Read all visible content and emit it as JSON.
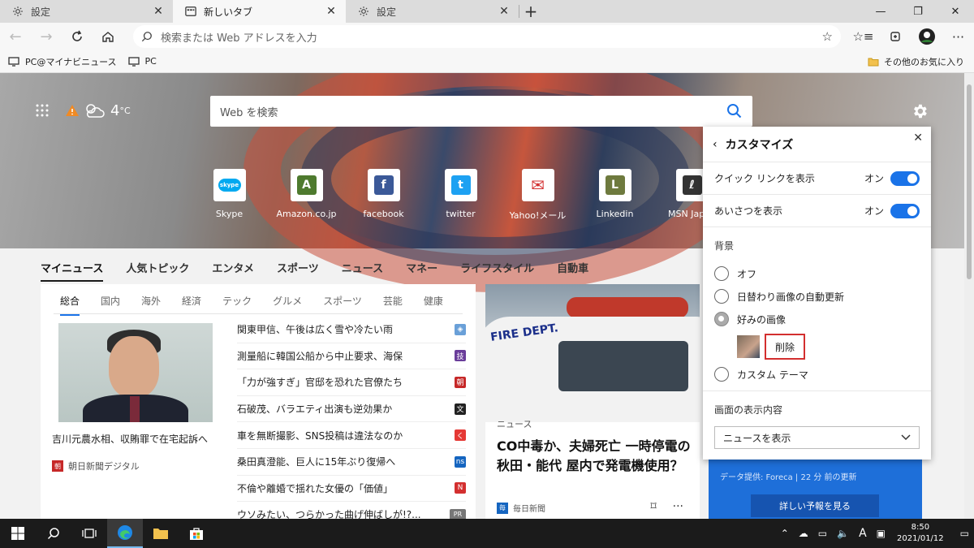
{
  "tabs": [
    {
      "label": "設定",
      "icon": "gear-icon"
    },
    {
      "label": "新しいタブ",
      "icon": "newtab-icon"
    },
    {
      "label": "設定",
      "icon": "gear-icon"
    }
  ],
  "address": {
    "placeholder": "検索または Web アドレスを入力"
  },
  "favorites": {
    "items": [
      {
        "label": "PC@マイナビニュース"
      },
      {
        "label": "PC"
      }
    ],
    "other": "その他のお気に入り"
  },
  "weather": {
    "temp": "4",
    "unit": "°C"
  },
  "search": {
    "placeholder": "Web を検索"
  },
  "quick_links": [
    {
      "label": "Skype",
      "icon": "skype-icon",
      "color": "#00a9f0",
      "glyph": "skype"
    },
    {
      "label": "Amazon.co.jp",
      "icon": "amazon-icon",
      "color": "#4e7a2e",
      "glyph": "A"
    },
    {
      "label": "facebook",
      "icon": "facebook-icon",
      "color": "#3b5998",
      "glyph": "f"
    },
    {
      "label": "twitter",
      "icon": "twitter-icon",
      "color": "#1da1f2",
      "glyph": "t"
    },
    {
      "label": "Yahoo!メール",
      "icon": "yahoo-mail-icon",
      "color": "#d32f2f",
      "glyph": "✉"
    },
    {
      "label": "Linkedin",
      "icon": "linkedin-icon",
      "color": "#6e7a3e",
      "glyph": "L"
    },
    {
      "label": "MSN Japan",
      "icon": "msn-icon",
      "color": "#333333",
      "glyph": "ℓ"
    }
  ],
  "news_nav": [
    "マイニュース",
    "人気トピック",
    "エンタメ",
    "スポーツ",
    "ニュース",
    "マネー",
    "ライフスタイル",
    "自動車"
  ],
  "sub_nav": [
    "総合",
    "国内",
    "海外",
    "経済",
    "テック",
    "グルメ",
    "スポーツ",
    "芸能",
    "健康"
  ],
  "feature": {
    "headline": "吉川元農水相、収賄罪で在宅起訴へ",
    "source": "朝日新聞デジタル",
    "badge": "朝"
  },
  "news_list": [
    {
      "title": "関東甲信、午後は広く雪や冷たい雨",
      "badge": "◈",
      "color": "#6aa0d8"
    },
    {
      "title": "測量船に韓国公船から中止要求、海保",
      "badge": "技",
      "color": "#6a3d9a"
    },
    {
      "title": "「力が強すぎ」官邸を恐れた官僚たち",
      "badge": "朝",
      "color": "#c62828"
    },
    {
      "title": "石破茂、バラエティ出演も逆効果か",
      "badge": "文",
      "color": "#222222"
    },
    {
      "title": "車を無断撮影、SNS投稿は違法なのか",
      "badge": "く",
      "color": "#e53935"
    },
    {
      "title": "桑田真澄能、巨人に15年ぶり復帰へ",
      "badge": "ns",
      "color": "#1565c0"
    },
    {
      "title": "不倫や離婚で揺れた女優の「価値」",
      "badge": "N",
      "color": "#d32f2f"
    },
    {
      "title": "ウソみたい、つらかった曲げ伸ばしが!?...",
      "badge": "PR",
      "color": "#777777"
    }
  ],
  "story2": {
    "sign": "FIRE DEPT.",
    "category": "ニュース",
    "headline": "CO中毒か、夫婦死亡 一時停電の秋田・能代 屋内で発電機使用？",
    "source": "毎日新聞",
    "badge": "毎"
  },
  "weather_card": {
    "info": "データ提供: Foreca | 22 分 前の更新",
    "button": "詳しい予報を見る"
  },
  "panel": {
    "title": "カスタマイズ",
    "quick_links_label": "クイック リンクを表示",
    "greeting_label": "あいさつを表示",
    "on": "オン",
    "background_title": "背景",
    "options": [
      "オフ",
      "日替わり画像の自動更新",
      "好みの画像",
      "カスタム テーマ"
    ],
    "delete": "削除",
    "content_title": "画面の表示内容",
    "content_value": "ニュースを表示"
  },
  "taskbar": {
    "time": "8:50",
    "date": "2021/01/12",
    "ime": "A"
  }
}
